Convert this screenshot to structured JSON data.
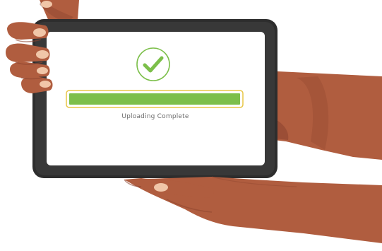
{
  "upload": {
    "status_text": "Uploading Complete",
    "progress_fraction": 1.0,
    "state": "complete"
  },
  "icons": {
    "status": "checkmark-icon"
  },
  "colors": {
    "skin": "#b05d3f",
    "skin_shadow": "#8e4530",
    "nail": "#f0c6a8",
    "tablet_frame": "#2d2d2d",
    "screen": "#ffffff",
    "progress_fill": "#7cbf4a",
    "progress_border": "#e8c546",
    "check_color": "#7cbf4a",
    "text": "#6b6b6b"
  }
}
